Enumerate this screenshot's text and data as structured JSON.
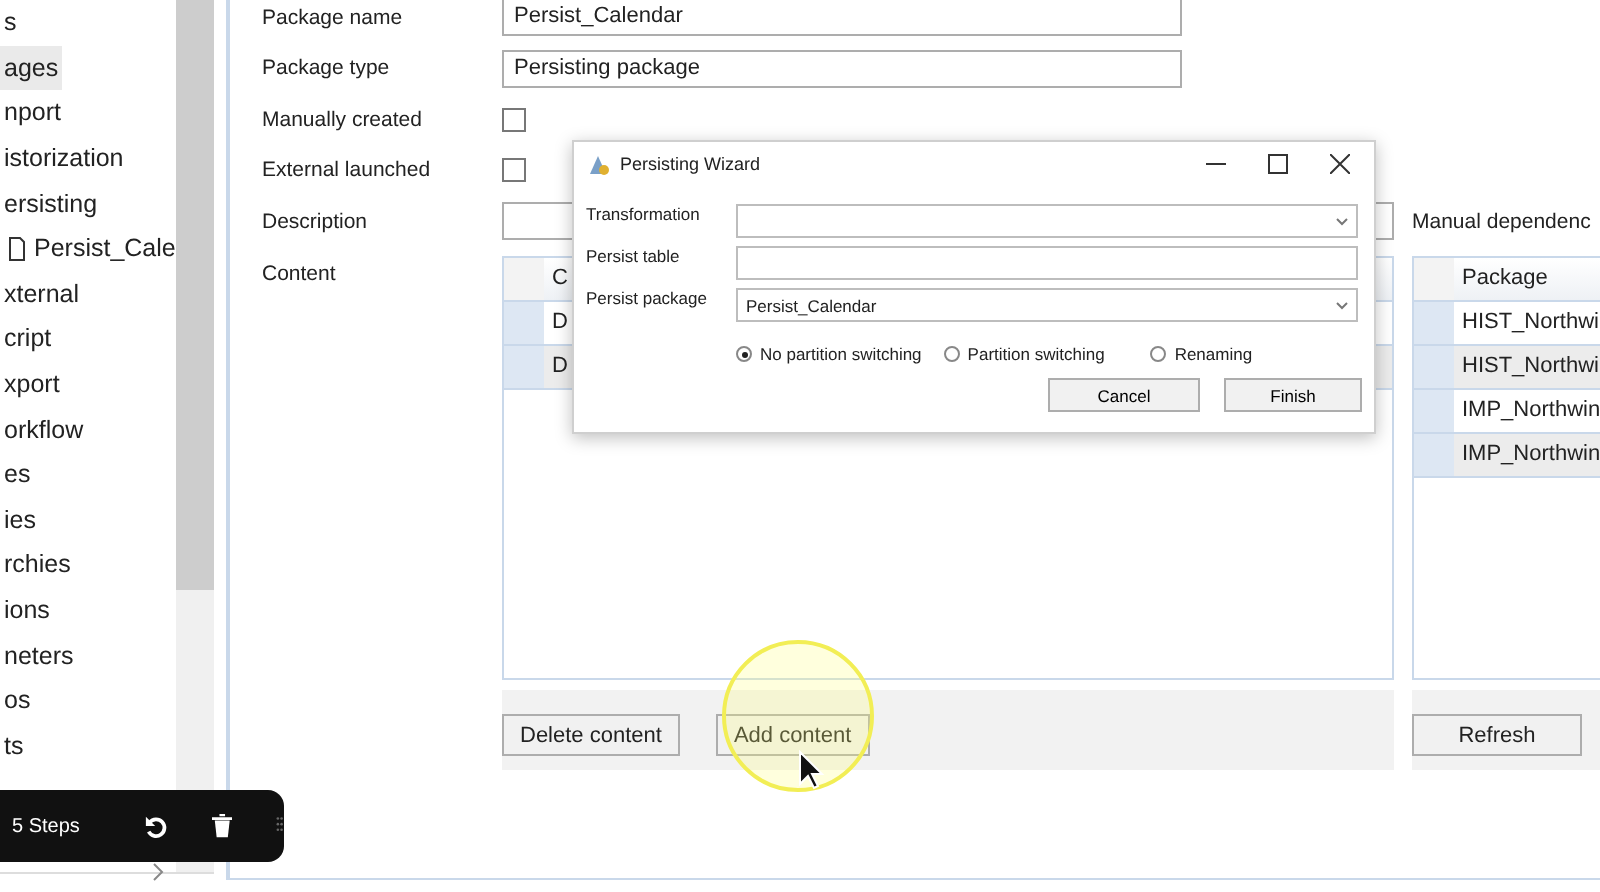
{
  "tree": {
    "items": [
      {
        "label": "s",
        "selected": false
      },
      {
        "label": "ages",
        "selected": true
      },
      {
        "label": "nport",
        "selected": false
      },
      {
        "label": "istorization",
        "selected": false
      },
      {
        "label": "ersisting",
        "selected": false,
        "children": [
          {
            "label": "Persist_Cale",
            "selected": false
          }
        ]
      },
      {
        "label": "xternal",
        "selected": false
      },
      {
        "label": "cript",
        "selected": false
      },
      {
        "label": "xport",
        "selected": false
      },
      {
        "label": "orkflow",
        "selected": false
      },
      {
        "label": "es",
        "selected": false
      },
      {
        "label": "ies",
        "selected": false
      },
      {
        "label": "rchies",
        "selected": false
      },
      {
        "label": "ions",
        "selected": false
      },
      {
        "label": "neters",
        "selected": false
      },
      {
        "label": "os",
        "selected": false
      },
      {
        "label": "ts",
        "selected": false
      }
    ]
  },
  "form_fields": [
    {
      "label": "Package name",
      "kind": "text",
      "value": "Persist_Calendar"
    },
    {
      "label": "Package type",
      "kind": "text",
      "value": "Persisting package"
    },
    {
      "label": "Manually created",
      "kind": "checkbox",
      "checked": false
    },
    {
      "label": "External launched",
      "kind": "checkbox",
      "checked": false
    },
    {
      "label": "Description",
      "kind": "wide_text"
    }
  ],
  "content": {
    "label": "Content",
    "columns": [
      "C"
    ],
    "rows": [
      "D",
      "D"
    ],
    "buttons": [
      "Delete content",
      "Add content"
    ]
  },
  "manual_dependencies": {
    "label": "Manual dependenc",
    "columns": [
      "Package"
    ],
    "rows": [
      "HIST_Northwi",
      "HIST_Northwi",
      "IMP_Northwin",
      "IMP_Northwin"
    ],
    "button": "Refresh"
  },
  "dialog": {
    "title": "Persisting Wizard",
    "fields": [
      {
        "label": "Transformation",
        "kind": "dropdown"
      },
      {
        "label": "Persist table",
        "kind": "text"
      },
      {
        "label": "Persist package",
        "kind": "dropdown",
        "value": "Persist_Calendar"
      }
    ],
    "options": [
      {
        "label": "No partition switching",
        "selected": true
      },
      {
        "label": "Partition switching",
        "selected": false
      },
      {
        "label": "Renaming",
        "selected": false
      }
    ],
    "buttons": [
      "Cancel",
      "Finish"
    ]
  },
  "steps_toolbar": {
    "label": "5 Steps"
  }
}
